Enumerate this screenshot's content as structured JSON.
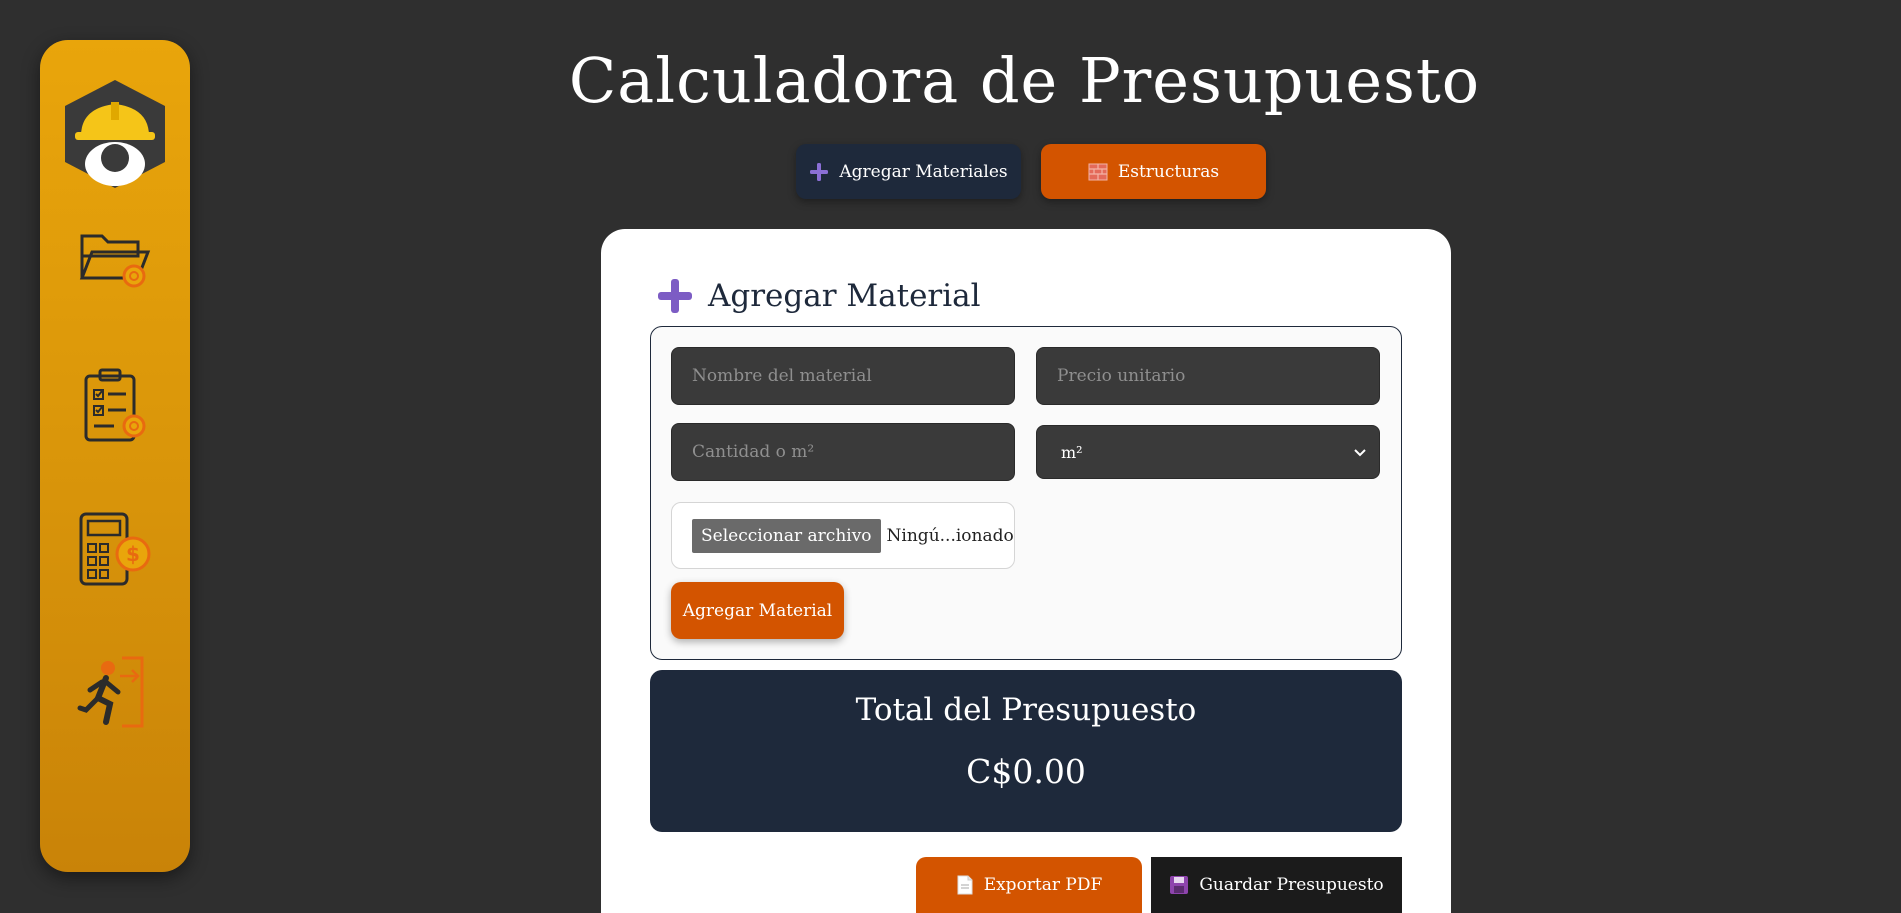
{
  "sidebar": {
    "items": [
      {
        "name": "logo-icon"
      },
      {
        "name": "folder-settings-icon"
      },
      {
        "name": "clipboard-checklist-icon"
      },
      {
        "name": "calculator-money-icon"
      },
      {
        "name": "logout-icon"
      }
    ]
  },
  "header": {
    "title": "Calculadora de Presupuesto",
    "tabs": [
      {
        "label": "Agregar Materiales",
        "icon": "plus-icon"
      },
      {
        "label": "Estructuras",
        "icon": "brick-wall-icon"
      }
    ]
  },
  "form": {
    "heading": "Agregar Material",
    "name_placeholder": "Nombre del material",
    "price_placeholder": "Precio unitario",
    "qty_placeholder": "Cantidad o m²",
    "unit_selected": "m²",
    "file_button": "Seleccionar archivo",
    "file_name": "Ningú...ionado",
    "submit_label": "Agregar Material"
  },
  "total": {
    "label": "Total del Presupuesto",
    "value": "C$0.00"
  },
  "actions": {
    "export_label": "Exportar PDF",
    "save_label": "Guardar Presupuesto"
  },
  "colors": {
    "background": "#2f2f2f",
    "sidebar": "#e9a50b",
    "accent_orange": "#d35400",
    "navy": "#1e293b",
    "purple": "#7c5cc4"
  }
}
